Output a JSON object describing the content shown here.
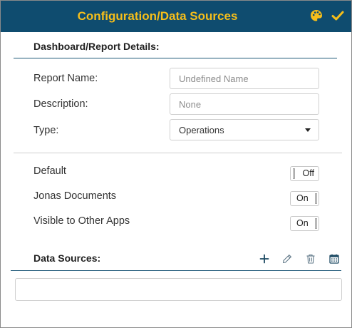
{
  "header": {
    "title": "Configuration/Data Sources",
    "accent_color": "#f5be1a",
    "background_color": "#0f4c6f",
    "icons": [
      "palette-icon",
      "check-icon"
    ]
  },
  "details": {
    "section_title": "Dashboard/Report Details:",
    "report_name": {
      "label": "Report Name:",
      "value": "",
      "placeholder": "Undefined Name"
    },
    "description": {
      "label": "Description:",
      "value": "",
      "placeholder": "None"
    },
    "type": {
      "label": "Type:",
      "selected": "Operations"
    }
  },
  "toggles": [
    {
      "label": "Default",
      "state": "Off"
    },
    {
      "label": "Jonas Documents",
      "state": "On"
    },
    {
      "label": "Visible to Other Apps",
      "state": "On"
    }
  ],
  "data_sources": {
    "section_title": "Data Sources:",
    "tools": [
      "plus-icon",
      "pencil-icon",
      "trash-icon",
      "calendar-icon"
    ],
    "items": []
  }
}
